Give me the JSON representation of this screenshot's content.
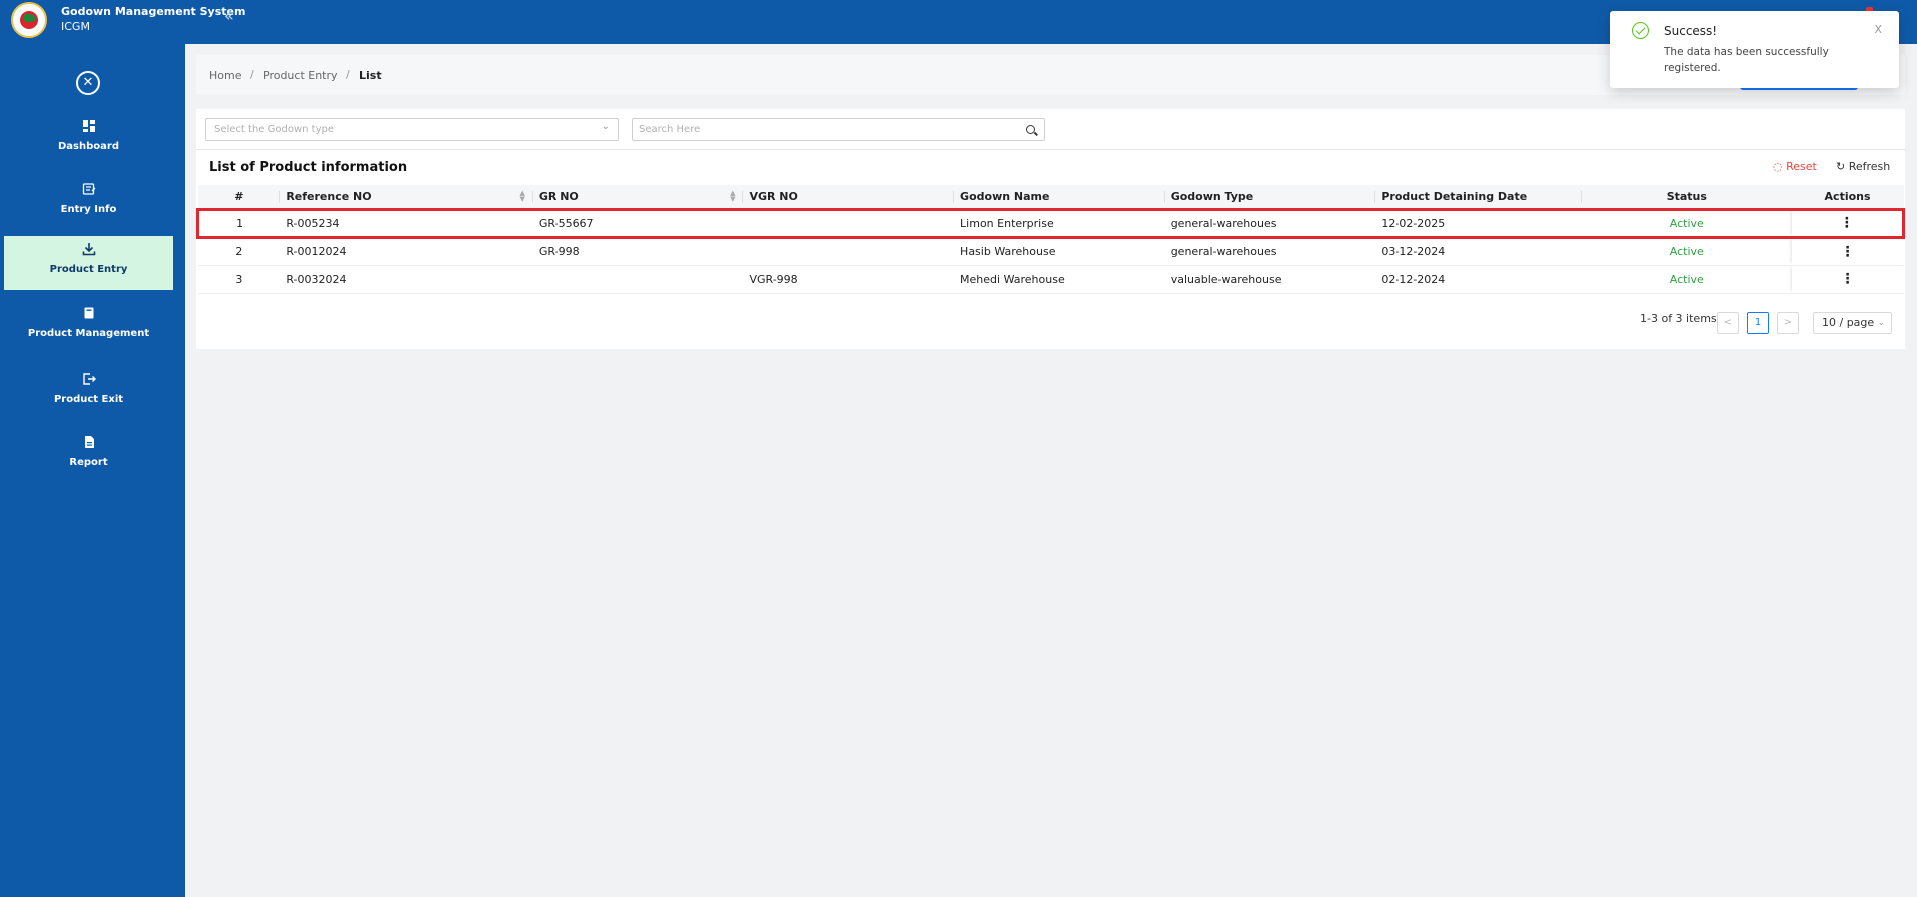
{
  "header": {
    "app_name": "Godown Management System",
    "app_sub": "ICGM",
    "collapse_glyph": "«",
    "colors": {
      "primary": "#0f5aa8",
      "active_nav": "#d5f5e3",
      "status_active": "#2f9e44",
      "reset": "#e5473c",
      "highlight": "#e0262e"
    }
  },
  "sidebar": {
    "close_glyph": "✕",
    "items": [
      {
        "label": "Dashboard",
        "icon": "dashboard-icon"
      },
      {
        "label": "Entry Info",
        "icon": "entry-info-icon"
      },
      {
        "label": "Product Entry",
        "icon": "download-icon"
      },
      {
        "label": "Product Management",
        "icon": "book-icon"
      },
      {
        "label": "Product Exit",
        "icon": "exit-icon"
      },
      {
        "label": "Report",
        "icon": "report-icon"
      }
    ]
  },
  "breadcrumb": {
    "home": "Home",
    "section": "Product Entry",
    "current": "List",
    "sep": "/"
  },
  "filters": {
    "godown_select_placeholder": "Select the Godown type",
    "search_placeholder": "Search Here"
  },
  "list": {
    "title": "List of Product information",
    "reset_label": "Reset",
    "refresh_label": "Refresh"
  },
  "table": {
    "columns": [
      "#",
      "Reference NO",
      "GR NO",
      "VGR NO",
      "Godown Name",
      "Godown Type",
      "Product Detaining Date",
      "Status",
      "Actions"
    ],
    "rows": [
      {
        "num": "1",
        "ref": "R-005234",
        "gr": "GR-55667",
        "vgr": "",
        "godown": "Limon Enterprise",
        "type": "general-warehoues",
        "date": "12-02-2025",
        "status": "Active"
      },
      {
        "num": "2",
        "ref": "R-0012024",
        "gr": "GR-998",
        "vgr": "",
        "godown": "Hasib Warehouse",
        "type": "general-warehoues",
        "date": "03-12-2024",
        "status": "Active"
      },
      {
        "num": "3",
        "ref": "R-0032024",
        "gr": "",
        "vgr": "VGR-998",
        "godown": "Mehedi Warehouse",
        "type": "valuable-warehouse",
        "date": "02-12-2024",
        "status": "Active"
      }
    ],
    "actions_glyph": "⋮"
  },
  "pagination": {
    "summary": "1-3 of 3 items",
    "prev": "<",
    "current_page": "1",
    "next": ">",
    "page_size": "10 / page"
  },
  "toast": {
    "title": "Success!",
    "message": "The data has been successfully registered.",
    "close": "X"
  }
}
